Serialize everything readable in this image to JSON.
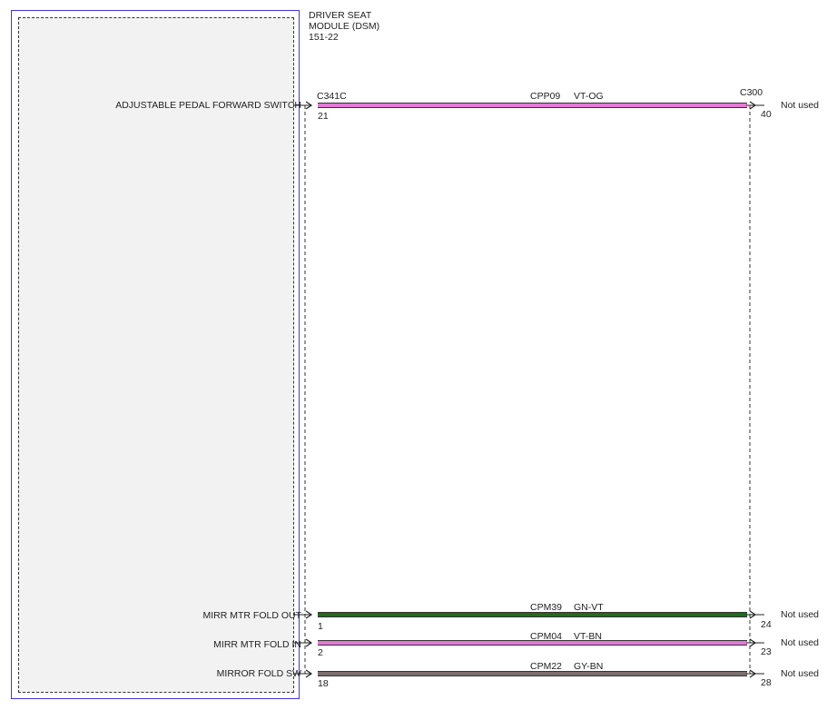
{
  "module": {
    "title_lines": [
      "DRIVER SEAT",
      "MODULE (DSM)",
      "151-22"
    ]
  },
  "connectors": {
    "left": "C341C",
    "right": "C300"
  },
  "circuits": [
    {
      "function": "ADJUSTABLE PEDAL FORWARD SWITCH",
      "circuit": "CPP09",
      "color_code": "VT-OG",
      "pin_left": "21",
      "pin_right": "40",
      "status": "Not used",
      "wire_color": "#e07ad6",
      "stripe_color": "#e07ad6"
    },
    {
      "function": "MIRR MTR FOLD OUT",
      "circuit": "CPM39",
      "color_code": "GN-VT",
      "pin_left": "1",
      "pin_right": "24",
      "status": "Not used",
      "wire_color": "#1f6b1f",
      "stripe_color": "#1f6b1f"
    },
    {
      "function": "MIRR MTR FOLD IN",
      "circuit": "CPM04",
      "color_code": "VT-BN",
      "pin_left": "2",
      "pin_right": "23",
      "status": "Not used",
      "wire_color": "#e07ad6",
      "stripe_color": "#e07ad6"
    },
    {
      "function": "MIRROR FOLD SW",
      "circuit": "CPM22",
      "color_code": "GY-BN",
      "pin_left": "18",
      "pin_right": "28",
      "status": "Not used",
      "wire_color": "#7d6f6f",
      "stripe_color": "#7d6f6f"
    }
  ]
}
